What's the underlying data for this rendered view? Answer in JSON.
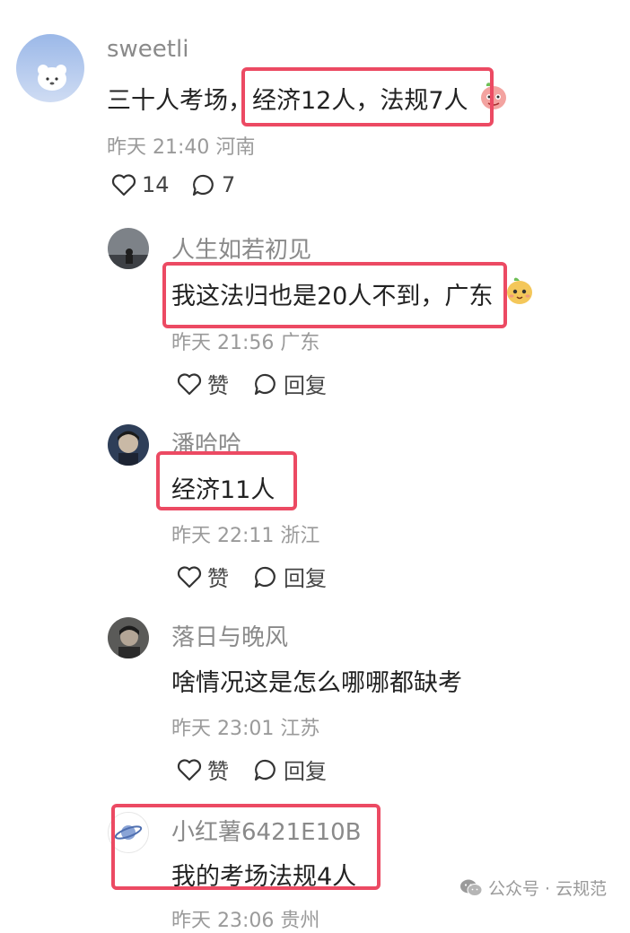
{
  "comments": [
    {
      "username": "sweetli",
      "text": "三十人考场，经济12人，法规7人",
      "meta": "昨天 21:40 河南",
      "likes": "14",
      "replies": "7"
    }
  ],
  "replies": [
    {
      "username": "人生如若初见",
      "text": "我这法归也是20人不到，广东",
      "meta": "昨天 21:56 广东",
      "like_label": "赞",
      "reply_label": "回复"
    },
    {
      "username": "潘哈哈",
      "text": "经济11人",
      "meta": "昨天 22:11 浙江",
      "like_label": "赞",
      "reply_label": "回复"
    },
    {
      "username": "落日与晚风",
      "text": "啥情况这是怎么哪哪都缺考",
      "meta": "昨天 23:01 江苏",
      "like_label": "赞",
      "reply_label": "回复"
    },
    {
      "username": "小红薯6421E10B",
      "text": "我的考场法规4人",
      "meta": "昨天 23:06 贵州"
    }
  ],
  "watermark": {
    "text": "公众号 · 云规范"
  },
  "colors": {
    "highlight": "#ec4a63",
    "muted": "#9a9a9a"
  }
}
